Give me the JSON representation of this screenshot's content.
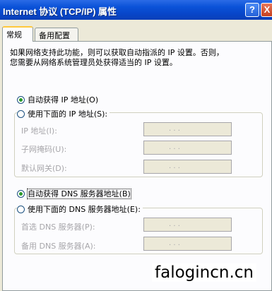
{
  "window": {
    "title": "Internet 协议 (TCP/IP) 属性",
    "help_label": "?",
    "close_label": "X"
  },
  "tabs": [
    {
      "label": "常规",
      "active": true
    },
    {
      "label": "备用配置",
      "active": false
    }
  ],
  "description": {
    "line1": "如果网络支持此功能，则可以获取自动指派的 IP 设置。否则，",
    "line2": "您需要从网络系统管理员处获得适当的 IP 设置。"
  },
  "ip": {
    "auto_label": "自动获得 IP 地址(O)",
    "auto_selected": true,
    "manual_label": "使用下面的 IP 地址(S):",
    "manual_selected": false,
    "fields": [
      {
        "label": "IP 地址(I):",
        "value": ". . ."
      },
      {
        "label": "子网掩码(U):",
        "value": ". . ."
      },
      {
        "label": "默认网关(D):",
        "value": ". . ."
      }
    ]
  },
  "dns": {
    "auto_label": "自动获得 DNS 服务器地址(B)",
    "auto_selected": true,
    "manual_label": "使用下面的 DNS 服务器地址(E):",
    "manual_selected": false,
    "fields": [
      {
        "label": "首选 DNS 服务器(P):",
        "value": ". . ."
      },
      {
        "label": "备用 DNS 服务器(A):",
        "value": ". . ."
      }
    ]
  },
  "watermark": "falogincn.cn",
  "colors": {
    "titlebar": "#0a52d8",
    "dialog_bg": "#ece9d8",
    "panel_bg": "#fcfcfe",
    "disabled_text": "#a7a6aa",
    "radio_dot": "#2a9a2a"
  }
}
